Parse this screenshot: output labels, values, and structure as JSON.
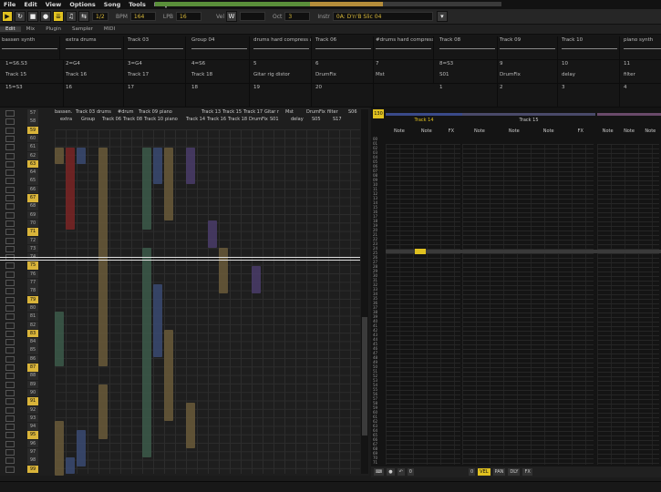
{
  "menu": [
    "File",
    "Edit",
    "View",
    "Options",
    "Song",
    "Tools",
    "Help"
  ],
  "transport": {
    "pattern_label": "1/2",
    "bpm_label": "BPM",
    "bpm": "164",
    "lpb_label": "LPB",
    "lpb": "16",
    "vel_label": "Vel",
    "oct_label": "Oct",
    "oct": "3",
    "instr_label": "Instr",
    "instr": "0A: D'n'B Slic 04"
  },
  "tabs": [
    "Edit",
    "Mix",
    "Plugin",
    "Sampler",
    "MIDI"
  ],
  "overview": {
    "row1": [
      [
        "bassen synth",
        0
      ],
      [
        "extra drums",
        70
      ],
      [
        "Track 03",
        138
      ],
      [
        "Group 04",
        208
      ],
      [
        "drums hard compress an..",
        276
      ],
      [
        "Track 06",
        344
      ],
      [
        "#drums hard compress ..",
        410
      ],
      [
        "Track 08",
        480
      ],
      [
        "Track 09",
        546
      ],
      [
        "Track 10",
        614
      ],
      [
        "piano synth",
        682
      ]
    ],
    "row2": [
      [
        "1=S6.S3",
        4
      ],
      [
        "2=G4",
        70
      ],
      [
        "3=G4",
        138
      ],
      [
        "4=S6",
        208
      ],
      [
        "5",
        276
      ],
      [
        "6",
        344
      ],
      [
        "7",
        410
      ],
      [
        "8=S3",
        480
      ],
      [
        "9",
        546
      ],
      [
        "10",
        614
      ],
      [
        "11",
        682
      ]
    ],
    "row2b": [
      [
        "Track 15",
        4
      ],
      [
        "Track 16",
        70
      ],
      [
        "Track 17",
        138
      ],
      [
        "Track 18",
        208
      ],
      [
        "Gitar rig distor",
        276
      ],
      [
        "DrumFix",
        344
      ],
      [
        "Mst",
        410
      ],
      [
        "S01",
        480
      ],
      [
        "DrumFix",
        546
      ],
      [
        "delay",
        614
      ],
      [
        "filter",
        682
      ]
    ],
    "row3": [
      [
        "15=S3",
        4
      ],
      [
        "16",
        70
      ],
      [
        "17",
        138
      ],
      [
        "18",
        208
      ],
      [
        "19",
        276
      ],
      [
        "20",
        344
      ],
      [
        "1",
        480
      ],
      [
        "2",
        546
      ],
      [
        "3",
        614
      ],
      [
        "4",
        682
      ]
    ]
  },
  "pattern": {
    "lines": [
      "57",
      "58",
      "59",
      "60",
      "61",
      "62",
      "63",
      "64",
      "65",
      "66",
      "67",
      "68",
      "69",
      "70",
      "71",
      "72",
      "73",
      "74",
      "75",
      "76",
      "77",
      "78",
      "79",
      "80",
      "81",
      "82",
      "83",
      "84",
      "85",
      "86",
      "87",
      "88",
      "89",
      "90",
      "91",
      "92",
      "93",
      "94",
      "95",
      "96",
      "97",
      "98",
      "99",
      "00",
      "01",
      "02",
      "03",
      "04",
      "05",
      "06",
      "07",
      "08",
      "09",
      "10",
      "11",
      "12",
      "13",
      "14",
      "15",
      "16",
      "17",
      "18",
      "19",
      "20",
      "21",
      "22",
      "23",
      "24",
      "25",
      "26",
      "27",
      "28",
      "29",
      "30",
      "31",
      "32",
      "33",
      "34",
      "35",
      "36",
      "37",
      "38",
      "39",
      "40",
      "41",
      "42",
      "43",
      "44",
      "45",
      "46",
      "47",
      "48",
      "49",
      "50",
      "51",
      "52",
      "53",
      "54",
      "55",
      "56"
    ],
    "hdr1": [
      "bassen.",
      "Track 03",
      "drums",
      "#drum",
      "Track 09",
      "piano",
      "",
      "Track 13",
      "Track 15",
      "Track 17",
      "Gitar r",
      "Mst",
      "DrumFix",
      "filter",
      "S06"
    ],
    "hdr2": [
      "extra",
      "Group",
      "Track 06",
      "Track 08",
      "Track 10",
      "piano",
      "Track 14",
      "Track 16",
      "Track 18",
      "DrumFix",
      "S01",
      "delay",
      "S05",
      "S17"
    ]
  },
  "phrase": {
    "cols": [
      [
        "Track 14",
        455
      ],
      [
        "Track 15",
        570
      ]
    ],
    "heads": [
      [
        "Note",
        "Note",
        "FX"
      ],
      [
        "Note",
        "Note",
        "Note",
        "FX"
      ],
      [
        "Note",
        "Note",
        "Note"
      ]
    ],
    "plus": "+",
    "num": "130"
  },
  "bottom": {
    "vel": "VEL",
    "pan": "PAN",
    "dly": "DLY",
    "fx": "FX",
    "val": "0"
  },
  "colors": {
    "accent": "#e0c120",
    "red": "#7a2424",
    "blue": "#3a4a72",
    "green": "#3c5a4a",
    "purple": "#4a3c6a",
    "tan": "#6a5a3a"
  }
}
